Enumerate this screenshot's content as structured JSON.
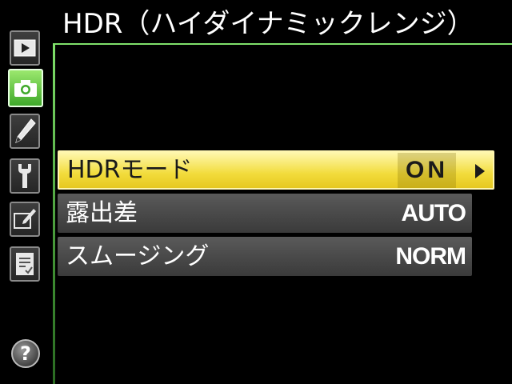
{
  "title": "HDR（ハイダイナミックレンジ）",
  "sidebar": {
    "tabs": [
      {
        "name": "playback-menu-icon",
        "active": false
      },
      {
        "name": "camera-menu-icon",
        "active": true
      },
      {
        "name": "pencil-menu-icon",
        "active": false
      },
      {
        "name": "wrench-menu-icon",
        "active": false
      },
      {
        "name": "retouch-menu-icon",
        "active": false
      },
      {
        "name": "my-menu-icon",
        "active": false
      }
    ],
    "help": "?"
  },
  "menu": {
    "items": [
      {
        "label": "HDRモード",
        "value": "ON",
        "selected": true
      },
      {
        "label": "露出差",
        "value": "AUTO",
        "selected": false
      },
      {
        "label": "スムージング",
        "value": "NORM",
        "selected": false
      }
    ]
  },
  "colors": {
    "accent": "#7fe06a",
    "highlight": "#f2dc3c",
    "row_bg": "#4a4a4a"
  }
}
